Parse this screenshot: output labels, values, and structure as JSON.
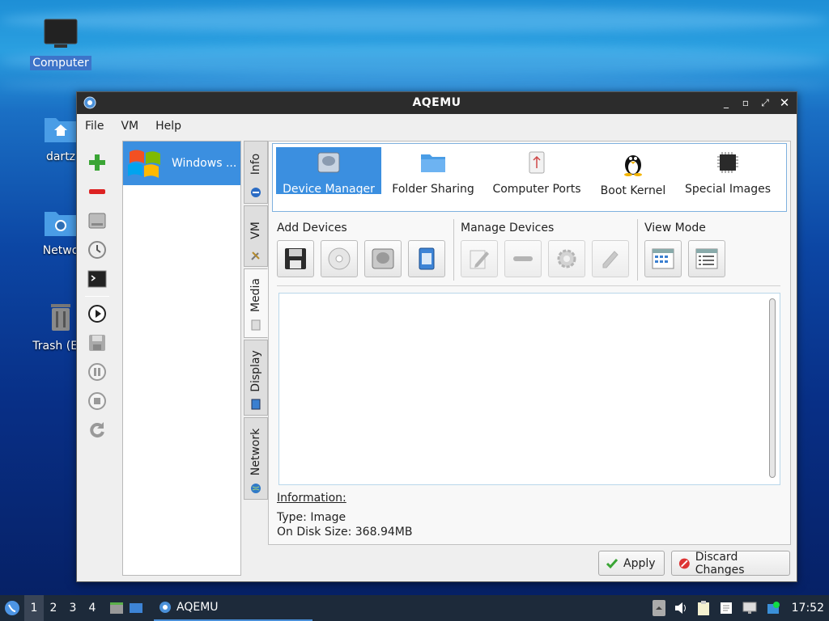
{
  "desktop": {
    "icons": [
      {
        "label": "Computer"
      },
      {
        "label": "dartz"
      },
      {
        "label": "Netwo"
      },
      {
        "label": "Trash (Em"
      }
    ]
  },
  "window": {
    "title": "AQEMU",
    "buttons": {
      "minimize": "_",
      "maximize": "▫",
      "restore": "⤢",
      "close": "✕"
    }
  },
  "menubar": [
    "File",
    "VM",
    "Help"
  ],
  "vm_list": [
    {
      "name": "Windows ...",
      "icon": "windows-logo-icon"
    }
  ],
  "side_tabs": [
    "Info",
    "VM",
    "Media",
    "Display",
    "Network"
  ],
  "categories": [
    {
      "label": "Device Manager",
      "icon": "hard-disk-icon"
    },
    {
      "label": "Folder Sharing",
      "icon": "folder-icon"
    },
    {
      "label": "Computer Ports",
      "icon": "usb-icon"
    },
    {
      "label": "Boot Kernel",
      "icon": "tux-icon"
    },
    {
      "label": "Special Images",
      "icon": "chip-icon"
    }
  ],
  "groups": {
    "add": "Add Devices",
    "manage": "Manage Devices",
    "view": "View Mode"
  },
  "info": {
    "heading": "Information:",
    "type": "Type: Image",
    "size": "On Disk Size: 368.94MB"
  },
  "dialog": {
    "apply": "Apply",
    "discard": "Discard Changes"
  },
  "taskbar": {
    "workspaces": [
      "1",
      "2",
      "3",
      "4"
    ],
    "task": "AQEMU",
    "clock": "17:52"
  },
  "colors": {
    "selection": "#3b8fe0",
    "titlebar": "#2c2c2c",
    "taskbar": "#1d2a3a"
  }
}
